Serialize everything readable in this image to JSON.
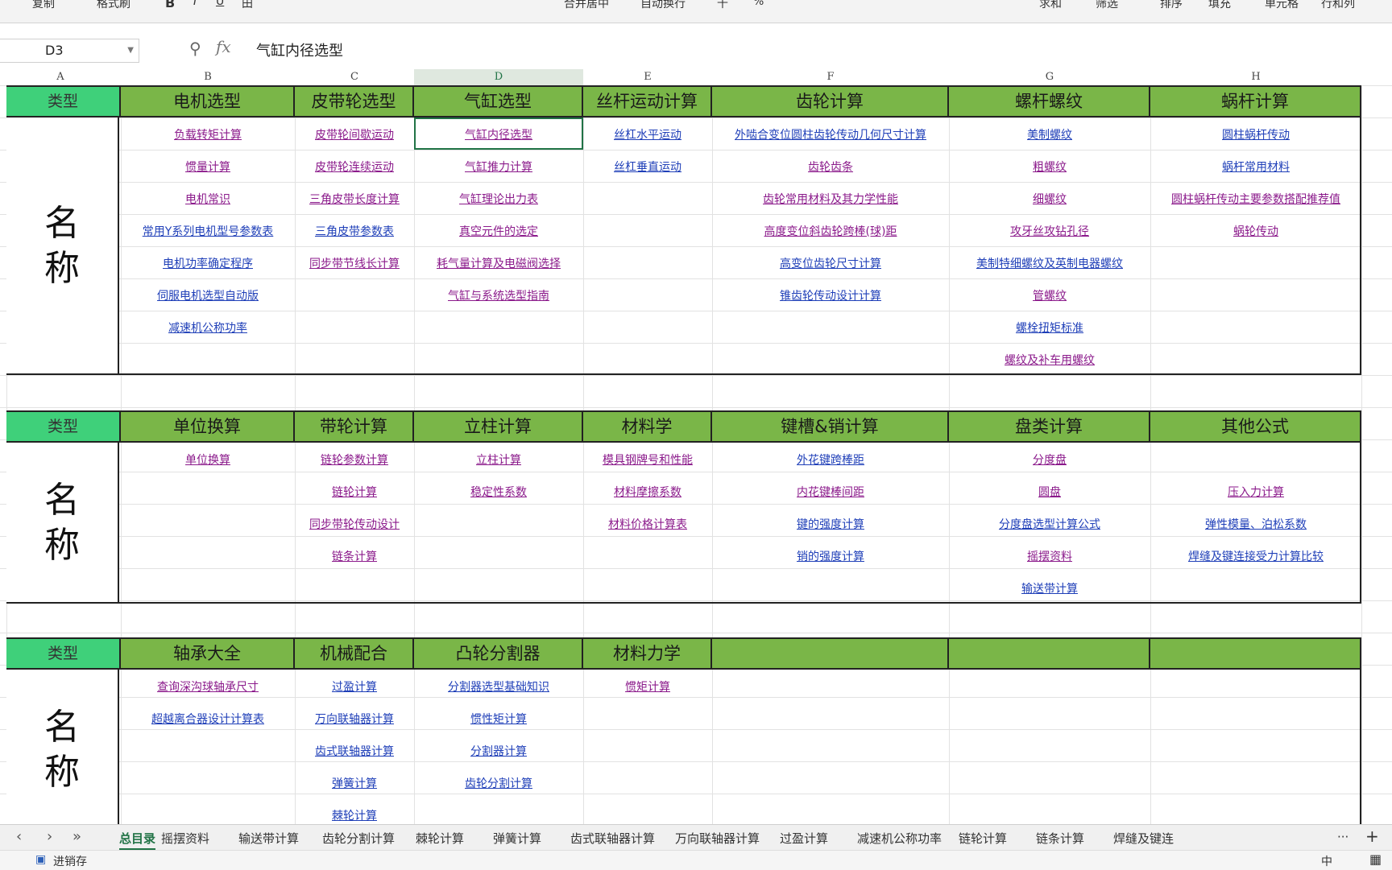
{
  "toolbar": {
    "items": [
      "复制",
      "格式刷",
      "B",
      "I",
      "U",
      "田",
      "合并居中",
      "自动换行",
      "千",
      "%",
      "填充",
      "排序",
      "求和",
      "筛选",
      "排序",
      "填充",
      "单元格",
      "行和列"
    ]
  },
  "formula_bar": {
    "cell_ref": "D3",
    "zoom_icon": "search-zoom-icon",
    "fx": "fx",
    "formula": "气缸内径选型"
  },
  "columns": [
    "A",
    "B",
    "C",
    "D",
    "E",
    "F",
    "G",
    "H"
  ],
  "blocks": [
    {
      "headers": [
        "类型",
        "电机选型",
        "皮带轮选型",
        "气缸选型",
        "丝杆运动计算",
        "齿轮计算",
        "螺杆螺纹",
        "蜗杆计算"
      ],
      "name_label": "名称",
      "rows": [
        [
          "负载转矩计算",
          "皮带轮间歇运动",
          "气缸内径选型",
          "丝杠水平运动",
          "外啮合变位圆柱齿轮传动几何尺寸计算",
          "美制螺纹",
          "圆柱蜗杆传动"
        ],
        [
          "惯量计算",
          "皮带轮连续运动",
          "气缸推力计算",
          "丝杠垂直运动",
          "齿轮齿条",
          "粗螺纹",
          "蜗杆常用材料"
        ],
        [
          "电机常识",
          "三角皮带长度计算",
          "气缸理论出力表",
          "",
          "齿轮常用材料及其力学性能",
          "细螺纹",
          "圆柱蜗杆传动主要参数搭配推荐值"
        ],
        [
          "常用Y系列电机型号参数表",
          "三角皮带参数表",
          "真空元件的选定",
          "",
          "高度变位斜齿轮跨棒(球)距",
          "攻牙丝攻钻孔径",
          "蜗轮传动"
        ],
        [
          "电机功率确定程序",
          "同步带节线长计算",
          "耗气量计算及电磁阀选择",
          "",
          "高变位齿轮尺寸计算",
          "美制特细螺纹及英制电器螺纹",
          ""
        ],
        [
          "伺服电机选型自动版",
          "",
          "气缸与系统选型指南",
          "",
          "锥齿轮传动设计计算",
          "管螺纹",
          ""
        ],
        [
          "减速机公称功率",
          "",
          "",
          "",
          "",
          "螺栓扭矩标准",
          ""
        ],
        [
          "",
          "",
          "",
          "",
          "",
          "螺纹及补车用螺纹",
          ""
        ]
      ]
    },
    {
      "headers": [
        "类型",
        "单位换算",
        "带轮计算",
        "立柱计算",
        "材料学",
        "键槽&销计算",
        "盘类计算",
        "其他公式"
      ],
      "name_label": "名称",
      "rows": [
        [
          "单位换算",
          "链轮参数计算",
          "立柱计算",
          "模具钢牌号和性能",
          "外花键跨棒距",
          "分度盘",
          ""
        ],
        [
          "",
          "链轮计算",
          "稳定性系数",
          "材料摩擦系数",
          "内花键棒间距",
          "圆盘",
          "压入力计算"
        ],
        [
          "",
          "同步带轮传动设计",
          "",
          "材料价格计算表",
          "键的强度计算",
          "分度盘选型计算公式",
          "弹性模量、泊松系数"
        ],
        [
          "",
          "链条计算",
          "",
          "",
          "销的强度计算",
          "摇摆资料",
          "焊缝及键连接受力计算比较"
        ],
        [
          "",
          "",
          "",
          "",
          "",
          "输送带计算",
          ""
        ]
      ]
    },
    {
      "headers": [
        "类型",
        "轴承大全",
        "机械配合",
        "凸轮分割器",
        "材料力学",
        "",
        "",
        ""
      ],
      "name_label": "名称",
      "rows": [
        [
          "查询深沟球轴承尺寸",
          "过盈计算",
          "分割器选型基础知识",
          "惯矩计算",
          "",
          "",
          ""
        ],
        [
          "超越离合器设计计算表",
          "万向联轴器计算",
          "惯性矩计算",
          "",
          "",
          "",
          ""
        ],
        [
          "",
          "齿式联轴器计算",
          "分割器计算",
          "",
          "",
          "",
          ""
        ],
        [
          "",
          "弹簧计算",
          "齿轮分割计算",
          "",
          "",
          "",
          ""
        ],
        [
          "",
          "棘轮计算",
          "",
          "",
          "",
          "",
          ""
        ]
      ]
    }
  ],
  "tabs": [
    "总目录",
    "摇摆资料",
    "输送带计算",
    "齿轮分割计算",
    "棘轮计算",
    "弹簧计算",
    "齿式联轴器计算",
    "万向联轴器计算",
    "过盈计算",
    "减速机公称功率",
    "链轮计算",
    "链条计算",
    "焊缝及键连"
  ],
  "active_tab": "总目录",
  "tab_more": "···",
  "tab_add": "+",
  "status": {
    "left_label": "进销存",
    "ime": "中"
  }
}
